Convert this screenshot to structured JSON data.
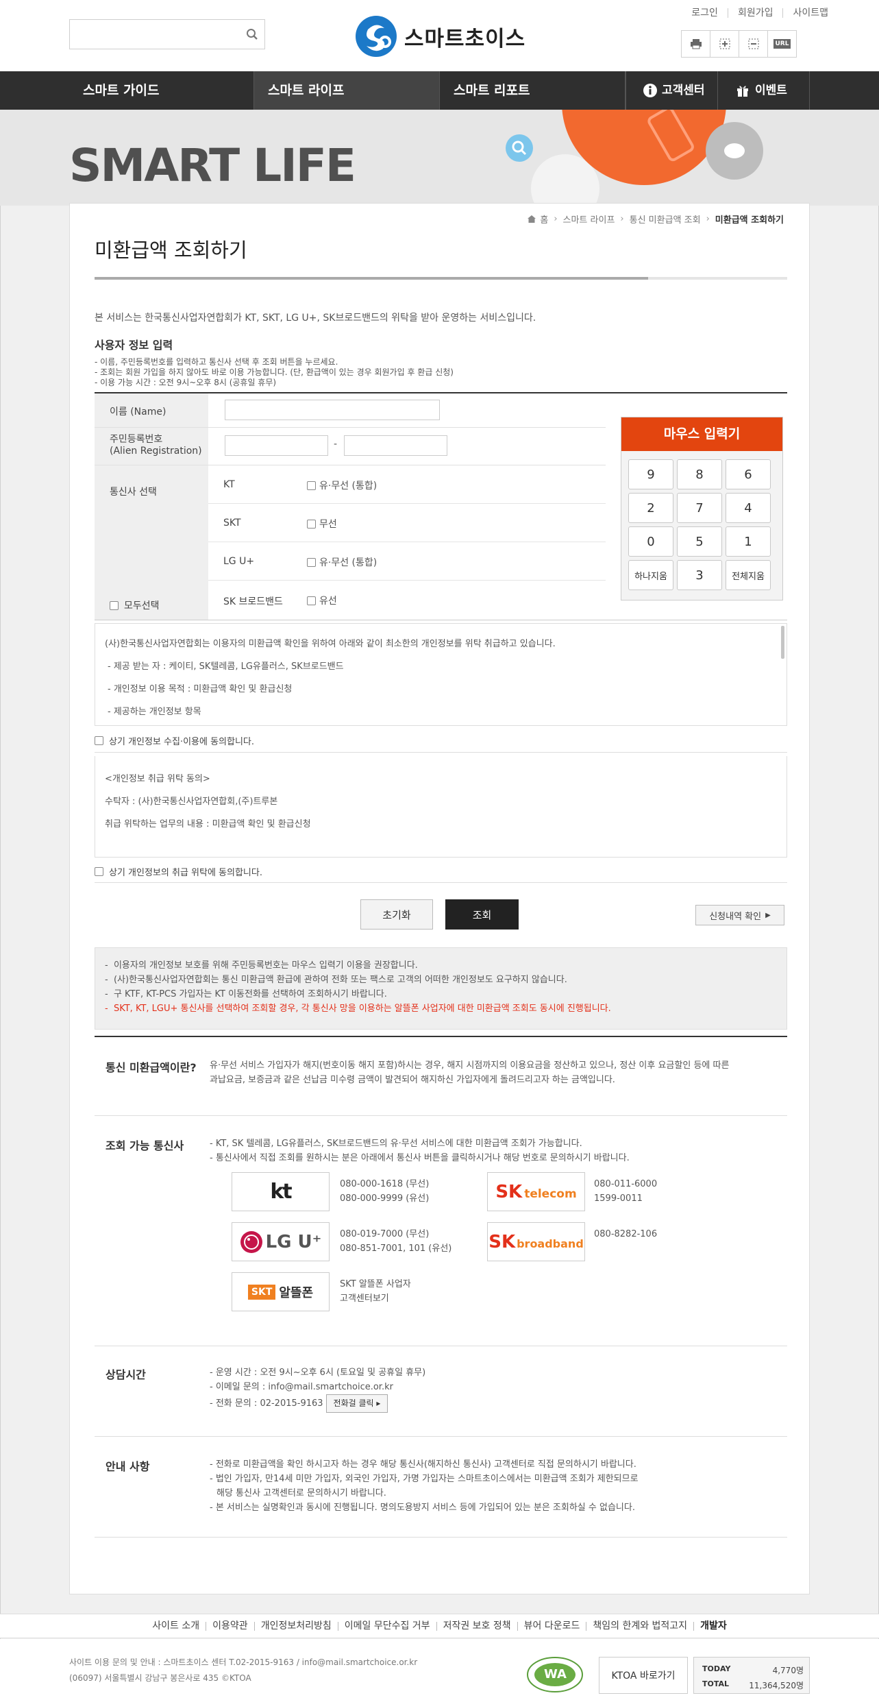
{
  "header": {
    "search_placeholder": "",
    "logo_text": "스마트초이스",
    "top_links": [
      "로그인",
      "회원가입",
      "사이트맵"
    ],
    "tool_icons": [
      "print-icon",
      "zoom-in-icon",
      "zoom-out-icon",
      "url-copy-icon"
    ],
    "url_label": "URL"
  },
  "nav": {
    "items": [
      "스마트 가이드",
      "스마트 라이프",
      "스마트 리포트"
    ],
    "customer_center": "고객센터",
    "event": "이벤트"
  },
  "banner": {
    "title": "SMART LIFE"
  },
  "breadcrumb": [
    "홈",
    "스마트 라이프",
    "통신 미환급액 조회",
    "미환급액 조회하기"
  ],
  "page": {
    "title": "미환급액 조회하기",
    "intro": "본 서비스는 한국통신사업자연합회가 KT, SKT, LG U+, SK브로드밴드의 위탁을 받아 운영하는 서비스입니다.",
    "section_title": "사용자 정보 입력",
    "notes": [
      "- 이름, 주민등록번호를 입력하고 통신사 선택 후 조회 버튼을 누르세요.",
      "- 조회는 회원 가입을 하지 않아도 바로 이용 가능합니다. (단, 환급액이 있는 경우 회원가입 후 환급 신청)",
      "- 이용 가능 시간 : 오전 9시~오후 8시 (공휴일 휴무)"
    ]
  },
  "form": {
    "name_label": "이름 (Name)",
    "name_value": "",
    "rrn_label_1": "주민등록번호",
    "rrn_label_2": "(Alien Registration)",
    "rrn_first": "",
    "rrn_second": "",
    "rrn_dash": "-",
    "carrier_label": "통신사 선택",
    "select_all": "모두선택",
    "carriers": [
      {
        "name": "KT",
        "option": "유·무선 (통합)"
      },
      {
        "name": "SKT",
        "option": "무선"
      },
      {
        "name": "LG U+",
        "option": "유·무선 (통합)"
      },
      {
        "name": "SK 브로드밴드",
        "option": "유선"
      }
    ]
  },
  "keypad": {
    "title": "마우스 입력기",
    "keys": [
      "9",
      "8",
      "6",
      "2",
      "7",
      "4",
      "0",
      "5",
      "1",
      "하나지움",
      "3",
      "전체지움"
    ]
  },
  "agreement1": {
    "lines": [
      "(사)한국통신사업자연합회는 이용자의 미환급액 확인을 위하여 아래와 같이 최소한의 개인정보를 위탁 취급하고 있습니다.",
      "- 제공 받는 자 : 케이티, SK텔레콤, LG유플러스, SK브로드밴드",
      "- 개인정보 이용 목적 : 미환급액 확인 및 환급신청",
      "- 제공하는 개인정보 항목"
    ],
    "check_label": "상기 개인정보 수집·이용에 동의합니다."
  },
  "agreement2": {
    "lines": [
      "<개인정보 취급 위탁 동의>",
      "수탁자 : (사)한국통신사업자연합회,(주)트루본",
      "취급 위탁하는 업무의 내용 : 미환급액 확인 및 환급신청"
    ],
    "check_label": "상기 개인정보의 취급 위탁에 동의합니다."
  },
  "buttons": {
    "reset": "초기화",
    "search": "조회",
    "history": "신청내역 확인"
  },
  "info_box": {
    "lines": [
      "이용자의 개인정보 보호를 위해 주민등록번호는 마우스 입력기 이용을 권장합니다.",
      "(사)한국통신사업자연합회는 통신 미환급액 환급에 관하여 전화 또는 팩스로 고객의 어떠한 개인정보도 요구하지 않습니다.",
      "구 KTF, KT-PCS 가입자는 KT 이동전화를 선택하여 조회하시기 바랍니다."
    ],
    "red_line": "SKT, KT, LGU+ 통신사를 선택하여 조회할 경우, 각 통신사 망을 이용하는 알뜰폰 사업자에 대한 미환급액 조회도 동시에 진행됩니다."
  },
  "sections": {
    "what": {
      "heading": "통신 미환급액이란?",
      "body_1": "유·무선 서비스 가입자가 해지(번호이동 해지 포함)하시는 경우, 해지 시점까지의 이용요금을 정산하고 있으나, 정산 이후 요금할인 등에 따른",
      "body_2": "과납요금, 보증금과 같은 선납금 미수령 금액이 발견되어 해지하신 가입자에게 돌려드리고자 하는 금액입니다."
    },
    "carriers": {
      "heading": "조회 가능 통신사",
      "body_1": "- KT, SK 텔레콤, LG유플러스, SK브로드밴드의 유·무선 서비스에 대한 미환급액 조회가 가능합니다.",
      "body_2": "- 통신사에서 직접 조회를 원하시는 분은 아래에서 통신사 버튼을 클릭하시거나 해당 번호로 문의하시기 바랍니다.",
      "kt_logo": "kt",
      "kt_tel": [
        "080-000-1618 (무선)",
        "080-000-9999 (유선)"
      ],
      "skt_logo_1": "SK",
      "skt_logo_2": "telecom",
      "skt_tel": [
        "080-011-6000",
        "1599-0011"
      ],
      "lgu_logo": "LG U⁺",
      "lgu_tel": [
        "080-019-7000 (무선)",
        "080-851-7001, 101 (유선)"
      ],
      "skb_logo_1": "SK",
      "skb_logo_2": "broadband",
      "skb_tel": [
        "080-8282-106"
      ],
      "mvno_logo_badge": "SKT",
      "mvno_logo_text": "알뜰폰",
      "mvno_text": [
        "SKT 알뜰폰 사업자",
        "고객센터보기"
      ]
    },
    "hours": {
      "heading": "상담시간",
      "line_1": "- 운영 시간 : 오전 9시~오후 6시 (토요일 및 공휴일 휴무)",
      "line_2": "- 이메일 문의 : info@mail.smartchoice.or.kr",
      "line_3": "- 전화 문의 : 02-2015-9163",
      "call_button": "전화걸 클릭"
    },
    "notice": {
      "heading": "안내 사항",
      "line_1": "- 전화로 미환급액을 확인 하시고자 하는 경우 해당 통신사(해지하신 통신사) 고객센터로 직접 문의하시기 바랍니다.",
      "line_2": "- 법인 가입자, 만14세 미만 가입자, 외국인 가입자, 가명 가입자는 스마트초이스에서는 미환급액 조회가 제한되므로",
      "line_3": "  해당 통신사 고객센터로 문의하시기 바랍니다.",
      "line_4": "- 본 서비스는 실명확인과 동시에 진행됩니다. 명의도용방지 서비스 등에 가입되어 있는 분은 조회하실 수 없습니다."
    }
  },
  "footer": {
    "links": [
      "사이트 소개",
      "이용약관",
      "개인정보처리방침",
      "이메일 무단수집 거부",
      "저작권 보호 정책",
      "뷰어 다운로드",
      "책임의 한계와 법적고지",
      "개발자"
    ],
    "address_1": "사이트 이용 문의 및 안내 : 스마트초이스 센터 T.02-2015-9163 / info@mail.smartchoice.or.kr",
    "address_2": "(06097) 서울특별시 강남구 봉은사로 435 ©KTOA",
    "ktoa_link": "KTOA 바로가기",
    "wa_badge": "WA",
    "today_label": "TODAY",
    "today_value": "4,770명",
    "total_label": "TOTAL",
    "total_value": "11,364,520명"
  }
}
